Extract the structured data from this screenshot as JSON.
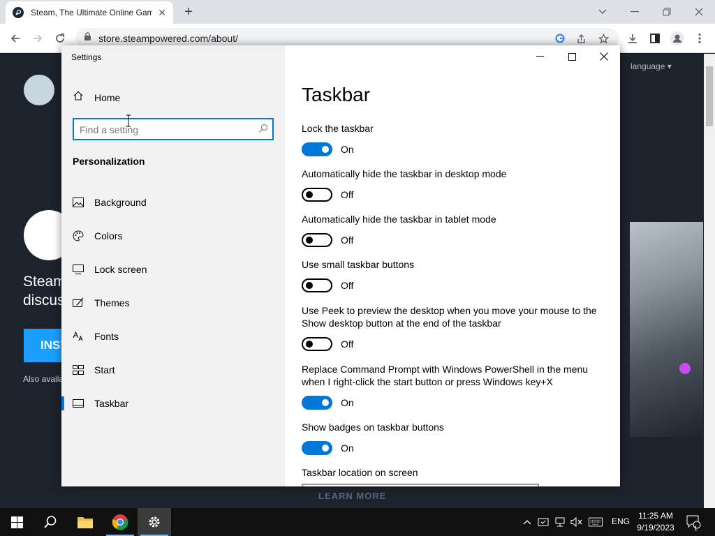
{
  "browser": {
    "tab_title": "Steam, The Ultimate Online Game Platform",
    "url": "store.steampowered.com/about/"
  },
  "steam_page": {
    "language": "language",
    "headline": "Steam discuss",
    "install_label": "INSTALL",
    "also_available": "Also available",
    "learn_more": "LEARN MORE"
  },
  "settings": {
    "window_title": "Settings",
    "home_label": "Home",
    "search_placeholder": "Find a setting",
    "section_heading": "Personalization",
    "nav_items": [
      {
        "label": "Background",
        "icon": "picture-icon"
      },
      {
        "label": "Colors",
        "icon": "palette-icon"
      },
      {
        "label": "Lock screen",
        "icon": "lock-screen-icon"
      },
      {
        "label": "Themes",
        "icon": "themes-icon"
      },
      {
        "label": "Fonts",
        "icon": "fonts-icon"
      },
      {
        "label": "Start",
        "icon": "start-icon"
      },
      {
        "label": "Taskbar",
        "icon": "taskbar-icon",
        "selected": true
      }
    ],
    "page_title": "Taskbar",
    "options": [
      {
        "label": "Lock the taskbar",
        "state": "On",
        "on": true
      },
      {
        "label": "Automatically hide the taskbar in desktop mode",
        "state": "Off",
        "on": false
      },
      {
        "label": "Automatically hide the taskbar in tablet mode",
        "state": "Off",
        "on": false
      },
      {
        "label": "Use small taskbar buttons",
        "state": "Off",
        "on": false
      },
      {
        "label": "Use Peek to preview the desktop when you move your mouse to the Show desktop button at the end of the taskbar",
        "state": "Off",
        "on": false
      },
      {
        "label": "Replace Command Prompt with Windows PowerShell in the menu when I right-click the start button or press Windows key+X",
        "state": "On",
        "on": true
      },
      {
        "label": "Show badges on taskbar buttons",
        "state": "On",
        "on": true
      }
    ],
    "location_label": "Taskbar location on screen",
    "accent_color": "#0078d7"
  },
  "taskbar": {
    "language": "ENG",
    "time": "11:25 AM",
    "date": "9/19/2023",
    "notification_count": "1"
  }
}
